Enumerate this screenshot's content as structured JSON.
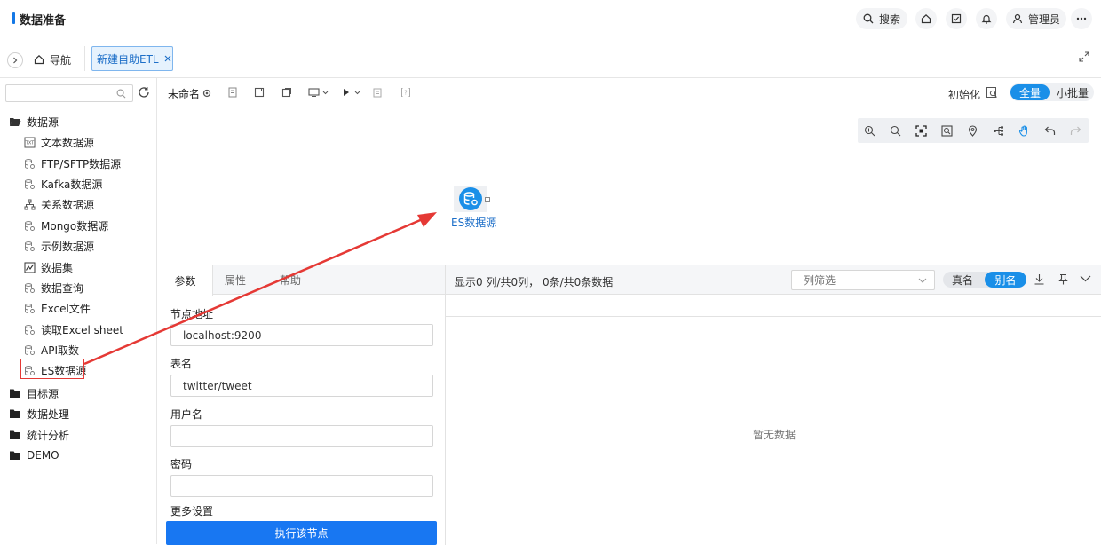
{
  "header": {
    "title": "数据准备",
    "search_label": "搜索",
    "user_label": "管理员"
  },
  "tabbar": {
    "nav_label": "导航",
    "active_tab_label": "新建自助ETL"
  },
  "sidebar": {
    "search_placeholder": "",
    "tree": [
      {
        "label": "数据源",
        "level": 0,
        "icon": "folder-open-icon"
      },
      {
        "label": "文本数据源",
        "level": 1,
        "icon": "text-file-icon"
      },
      {
        "label": "FTP/SFTP数据源",
        "level": 1,
        "icon": "datasource-icon"
      },
      {
        "label": "Kafka数据源",
        "level": 1,
        "icon": "datasource-icon"
      },
      {
        "label": "关系数据源",
        "level": 1,
        "icon": "relation-icon"
      },
      {
        "label": "Mongo数据源",
        "level": 1,
        "icon": "datasource-icon"
      },
      {
        "label": "示例数据源",
        "level": 1,
        "icon": "datasource-icon"
      },
      {
        "label": "数据集",
        "level": 1,
        "icon": "dataset-icon"
      },
      {
        "label": "数据查询",
        "level": 1,
        "icon": "datasource-icon"
      },
      {
        "label": "Excel文件",
        "level": 1,
        "icon": "datasource-icon"
      },
      {
        "label": "读取Excel sheet",
        "level": 1,
        "icon": "datasource-icon"
      },
      {
        "label": "API取数",
        "level": 1,
        "icon": "datasource-icon"
      },
      {
        "label": "ES数据源",
        "level": 1,
        "icon": "datasource-icon"
      },
      {
        "label": "目标源",
        "level": 0,
        "icon": "folder-icon"
      },
      {
        "label": "数据处理",
        "level": 0,
        "icon": "folder-icon"
      },
      {
        "label": "统计分析",
        "level": 0,
        "icon": "folder-icon"
      },
      {
        "label": "DEMO",
        "level": 0,
        "icon": "folder-icon"
      }
    ]
  },
  "toolbar": {
    "flow_name": "未命名",
    "init_label": "初始化",
    "mode_full": "全量",
    "mode_batch": "小批量"
  },
  "canvas": {
    "node_label": "ES数据源"
  },
  "params": {
    "tabs": [
      "参数",
      "属性",
      "帮助"
    ],
    "node_address_label": "节点地址",
    "node_address_value": "localhost:9200",
    "table_name_label": "表名",
    "table_name_value": "twitter/tweet",
    "username_label": "用户名",
    "username_value": "",
    "password_label": "密码",
    "password_value": "",
    "more_settings_label": "更多设置",
    "run_button": "执行该节点"
  },
  "data_preview": {
    "summary": "显示0 列/共0列， 0条/共0条数据",
    "column_filter_placeholder": "列筛选",
    "real_name_label": "真名",
    "alias_label": "别名",
    "empty_text": "暂无数据"
  },
  "colors": {
    "accent": "#1877f2",
    "annotation": "#e53935"
  }
}
